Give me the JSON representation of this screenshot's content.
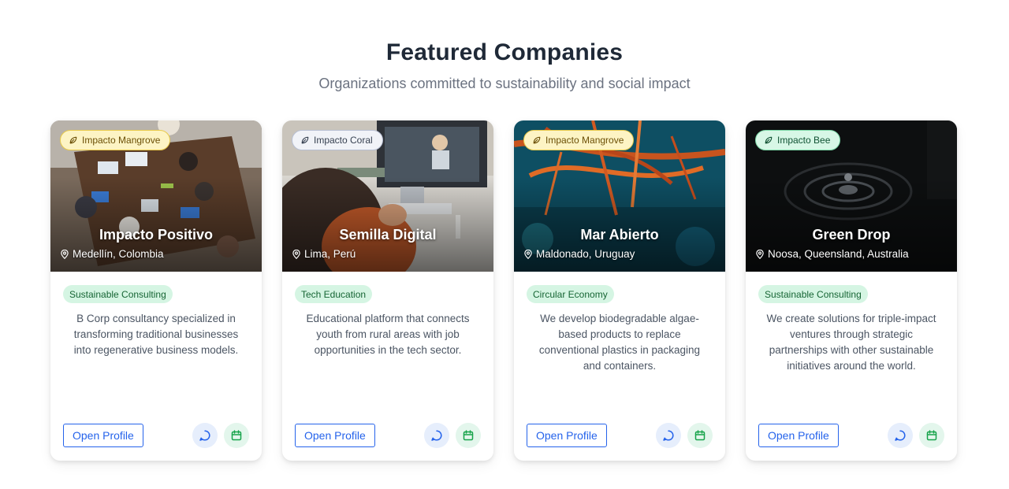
{
  "header": {
    "title": "Featured Companies",
    "subtitle": "Organizations committed to sustainability and social impact"
  },
  "colors": {
    "primary": "#2563eb",
    "accent_green": "#16a34a",
    "badge_mangrove": "#fdf4c4",
    "badge_coral": "#f1f3f8",
    "badge_bee": "#d7f7e6"
  },
  "cards": [
    {
      "badge": "Impacto Mangrove",
      "badge_icon": "leaf-icon",
      "name": "Impacto Positivo",
      "location": "Medellín, Colombia",
      "category": "Sustainable Consulting",
      "description": "B Corp consultancy specialized in transforming traditional businesses into regenerative business models.",
      "action_label": "Open Profile",
      "icons": [
        "chat-icon",
        "calendar-icon"
      ]
    },
    {
      "badge": "Impacto Coral",
      "badge_icon": "leaf-icon",
      "name": "Semilla Digital",
      "location": "Lima, Perú",
      "category": "Tech Education",
      "description": "Educational platform that connects youth from rural areas with job opportunities in the tech sector.",
      "action_label": "Open Profile",
      "icons": [
        "chat-icon",
        "calendar-icon"
      ]
    },
    {
      "badge": "Impacto Mangrove",
      "badge_icon": "leaf-icon",
      "name": "Mar Abierto",
      "location": "Maldonado, Uruguay",
      "category": "Circular Economy",
      "description": "We develop biodegradable algae-based products to replace conventional plastics in packaging and containers.",
      "action_label": "Open Profile",
      "icons": [
        "chat-icon",
        "calendar-icon"
      ]
    },
    {
      "badge": "Impacto Bee",
      "badge_icon": "leaf-icon",
      "name": "Green Drop",
      "location": "Noosa, Queensland, Australia",
      "category": "Sustainable Consulting",
      "description": "We create solutions for triple-impact ventures through strategic partnerships with other sustainable initiatives around the world.",
      "action_label": "Open Profile",
      "icons": [
        "chat-icon",
        "calendar-icon"
      ]
    }
  ]
}
